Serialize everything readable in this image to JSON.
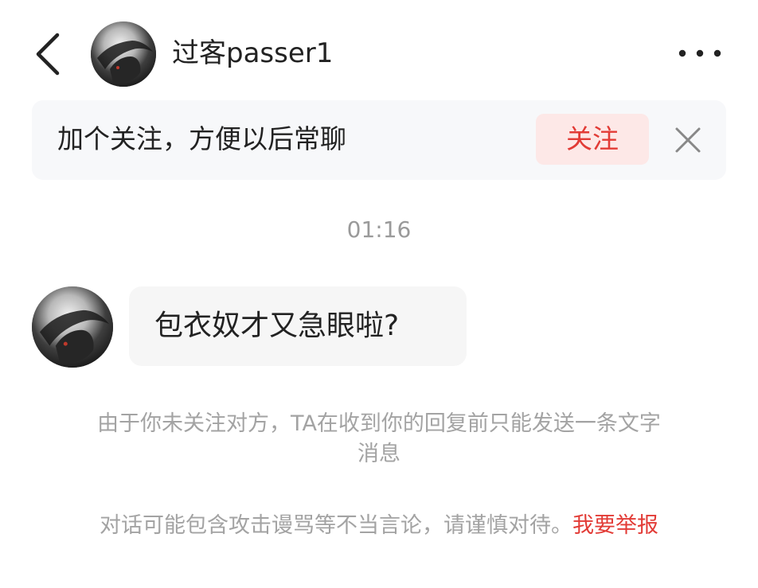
{
  "header": {
    "back_icon": "chevron-left-icon",
    "avatar_alt": "user avatar",
    "title": "过客passer1",
    "more_icon": "more-horizontal-icon"
  },
  "follow_banner": {
    "text": "加个关注，方便以后常聊",
    "follow_label": "关注",
    "close_icon": "close-icon"
  },
  "timestamp": "01:16",
  "messages": [
    {
      "sender": "过客passer1",
      "text": "包衣奴才又急眼啦?"
    }
  ],
  "notices": {
    "limit_notice_line1": "由于你未关注对方，TA在收到你的回复前只能发送一条文字",
    "limit_notice_line2": "消息",
    "safety_notice": "对话可能包含攻击谩骂等不当言论，请谨慎对待。",
    "report_label": "我要举报"
  },
  "colors": {
    "accent": "#e23b36",
    "accent_bg": "#fde8e7",
    "banner_bg": "#f7f8fa",
    "bubble_bg": "#f6f6f6",
    "muted_text": "#9a9a9a"
  }
}
